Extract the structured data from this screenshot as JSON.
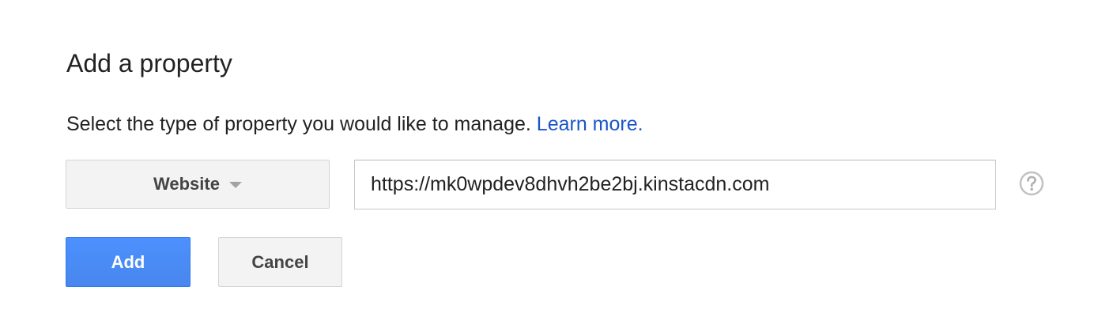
{
  "dialog": {
    "title": "Add a property",
    "description": "Select the type of property you would like to manage.",
    "learn_more_link": "Learn more.",
    "property_type": {
      "selected": "Website"
    },
    "url_input": {
      "value": "https://mk0wpdev8dhvh2be2bj.kinstacdn.com"
    },
    "help_icon": "help-circle-icon",
    "buttons": {
      "add_label": "Add",
      "cancel_label": "Cancel"
    }
  },
  "colors": {
    "link": "#1a55c9",
    "primary_button": "#4d90fe",
    "secondary_button": "#f3f3f3",
    "text": "#222222"
  }
}
